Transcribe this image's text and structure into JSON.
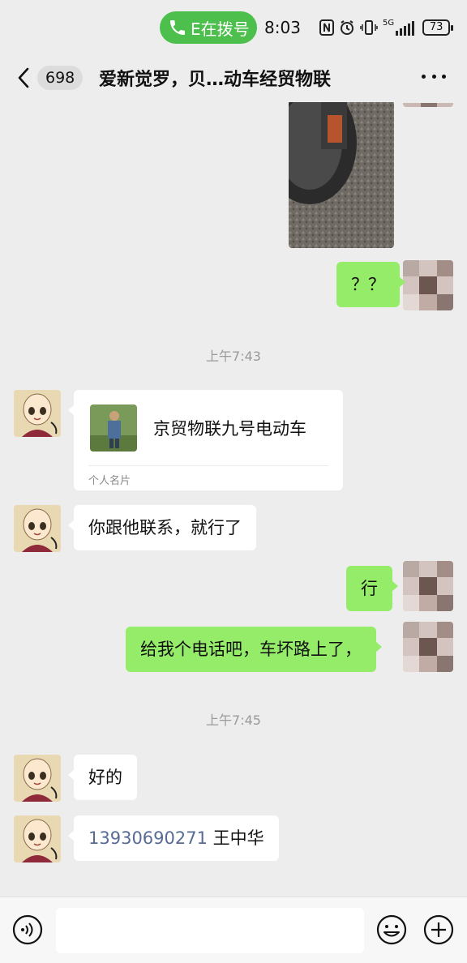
{
  "status_bar": {
    "call_indicator": "E在拨号",
    "call_icon": "phone-icon",
    "time": "8:03",
    "icons": [
      "nfc-icon",
      "alarm-icon",
      "vibrate-icon",
      "signal-5g-icon"
    ],
    "network_label": "5G",
    "battery_level": "73"
  },
  "header": {
    "back_icon": "chevron-left-icon",
    "unread_count": "698",
    "title": "爱新觉罗，贝…动车经贸物联",
    "more_icon": "more-dots-icon"
  },
  "messages": [
    {
      "kind": "image",
      "side": "right",
      "description_icon": "photo-thumbnail"
    },
    {
      "kind": "text",
      "side": "right",
      "text": "？？"
    },
    {
      "kind": "timestamp",
      "text": "上午7:43"
    },
    {
      "kind": "contact_card",
      "side": "left",
      "name": "京贸物联九号电动车",
      "label": "个人名片"
    },
    {
      "kind": "text",
      "side": "left",
      "text": "你跟他联系，就行了"
    },
    {
      "kind": "text",
      "side": "right",
      "text": "行"
    },
    {
      "kind": "text",
      "side": "right",
      "text": "给我个电话吧，车坏路上了，"
    },
    {
      "kind": "timestamp",
      "text": "上午7:45"
    },
    {
      "kind": "text",
      "side": "left",
      "text": "好的"
    },
    {
      "kind": "text",
      "side": "left",
      "phone": "13930690271",
      "text": "王中华"
    }
  ],
  "input_bar": {
    "voice_icon": "voice-icon",
    "input_value": "",
    "emoji_icon": "emoji-icon",
    "plus_icon": "plus-circle-icon"
  },
  "colors": {
    "self_bubble": "#95ec69",
    "other_bubble": "#ffffff",
    "background": "#ededed",
    "call_pill": "#4cbf4c",
    "link": "#576b95"
  }
}
